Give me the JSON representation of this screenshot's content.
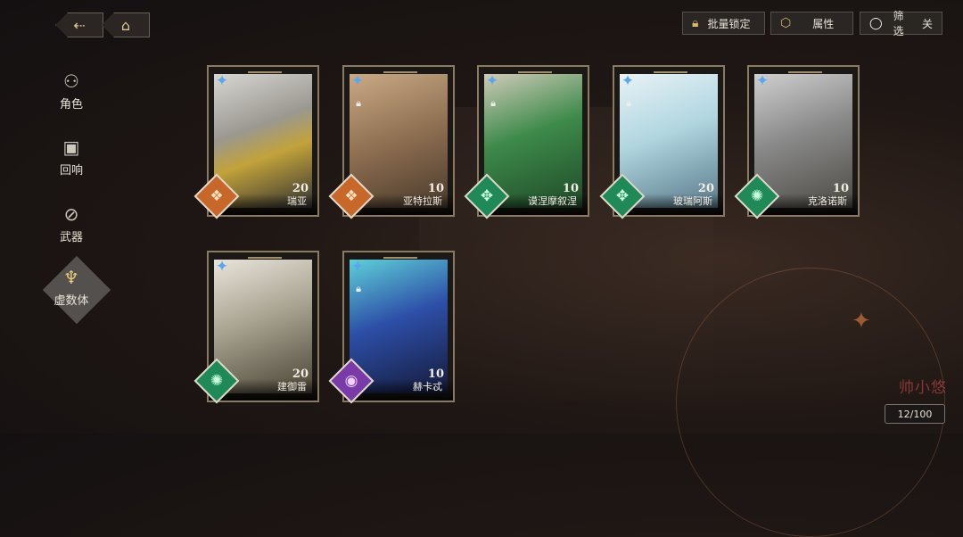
{
  "top_nav": {
    "back_icon": "back-arrow-icon",
    "home_icon": "home-icon"
  },
  "toolbar": {
    "batch_lock_label": "批量锁定",
    "attribute_label": "属性",
    "filter_label": "筛选",
    "filter_state": "关"
  },
  "sidebar": {
    "items": [
      {
        "label": "角色",
        "icon": "character-icon",
        "active": false
      },
      {
        "label": "回响",
        "icon": "echo-icon",
        "active": false
      },
      {
        "label": "武器",
        "icon": "weapon-icon",
        "active": false
      },
      {
        "label": "虚数体",
        "icon": "imaginary-body-icon",
        "active": true
      }
    ]
  },
  "cards": [
    {
      "name": "瑞亚",
      "level": "20",
      "locked": false,
      "attribute": "orange",
      "art": "gold-white mech"
    },
    {
      "name": "亚特拉斯",
      "level": "10",
      "locked": true,
      "attribute": "orange",
      "art": "sand mech"
    },
    {
      "name": "谟涅摩叙涅",
      "level": "10",
      "locked": true,
      "attribute": "green",
      "art": "green mech"
    },
    {
      "name": "玻瑞阿斯",
      "level": "20",
      "locked": true,
      "attribute": "green",
      "art": "ice mech"
    },
    {
      "name": "克洛诺斯",
      "level": "10",
      "locked": false,
      "attribute": "green",
      "art": "silver mech"
    },
    {
      "name": "建御雷",
      "level": "20",
      "locked": false,
      "attribute": "green",
      "art": "white-gold mech"
    },
    {
      "name": "赫卡忒",
      "level": "10",
      "locked": true,
      "attribute": "purple",
      "art": "blue flame mech"
    }
  ],
  "colors": {
    "attr_orange": "#c7672a",
    "attr_green": "#1f8a57",
    "attr_purple": "#7a3aa8",
    "rank_blue": "#5aa6f0",
    "frame_gold": "#8a7a62"
  },
  "inventory_count": "12/100"
}
